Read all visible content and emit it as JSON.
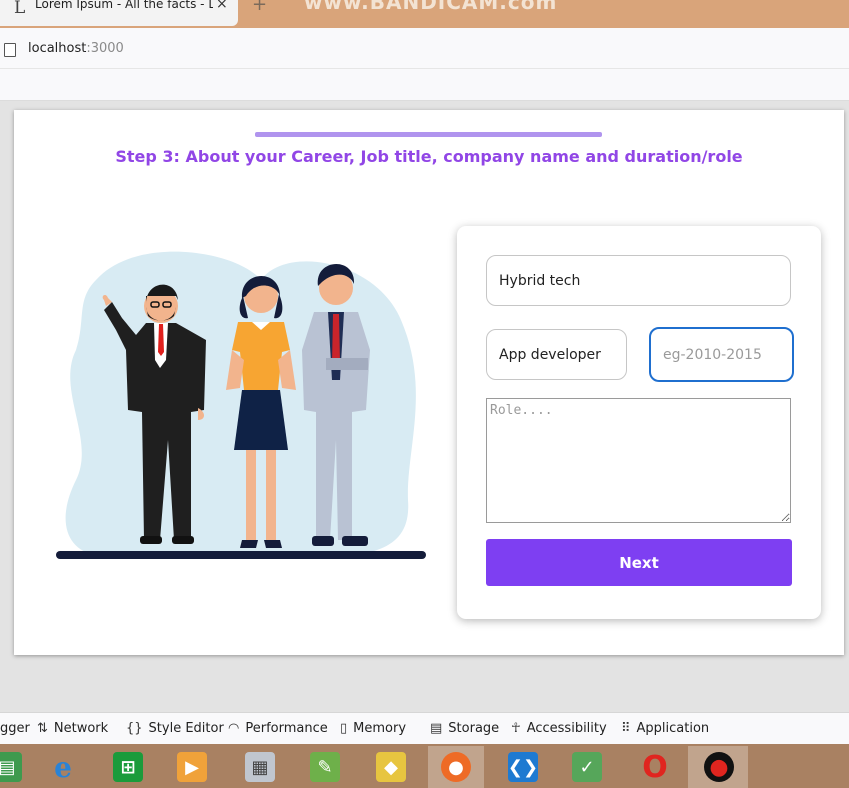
{
  "browser": {
    "tab_title": "Lorem Ipsum - All the facts - Li",
    "tab_favicon": "L",
    "tab_close": "×",
    "new_tab": "+",
    "watermark": "www.BANDICAM.com",
    "url_host": "localhost",
    "url_port": ":3000"
  },
  "page": {
    "step_title": "Step 3: About your Career, Job title, company name and duration/role",
    "form": {
      "company_value": "Hybrid tech",
      "job_title_value": "App developer",
      "duration_placeholder": "eg-2010-2015",
      "role_placeholder": "Role....",
      "next_label": "Next"
    }
  },
  "devtools": {
    "items": [
      "gger",
      "Network",
      "Style Editor",
      "Performance",
      "Memory",
      "Storage",
      "Accessibility",
      "Application"
    ]
  },
  "taskbar": {
    "apps": [
      "file-explorer-icon",
      "internet-explorer-icon",
      "store-icon",
      "media-player-icon",
      "calculator-icon",
      "notepad-plus-plus-icon",
      "paint-icon",
      "firefox-icon",
      "vscode-icon",
      "apk-editor-icon",
      "opera-icon",
      "bandicam-icon"
    ]
  },
  "colors": {
    "accent": "#7e3ff2",
    "title": "#9146e6",
    "progress": "#b094ee",
    "focus": "#1f6fcf"
  }
}
